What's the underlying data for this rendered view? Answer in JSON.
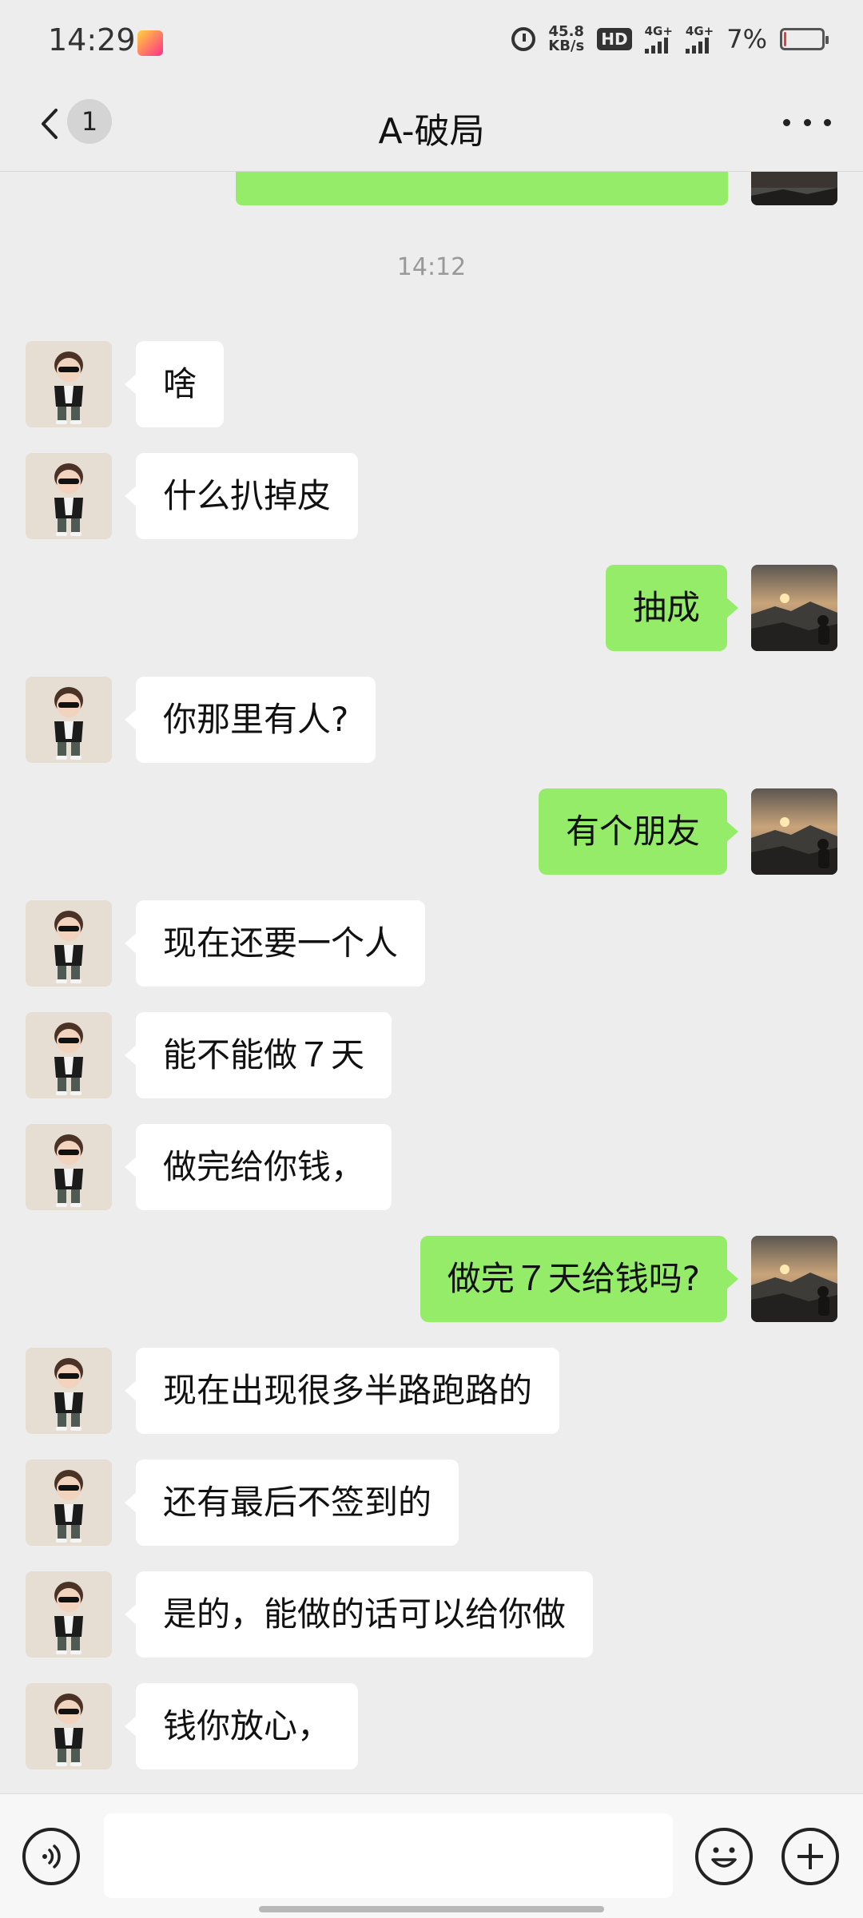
{
  "status_bar": {
    "time": "14:29",
    "net_speed_value": "45.8",
    "net_speed_unit": "KB/s",
    "hd_label": "HD",
    "sim1_label": "4G+",
    "sim2_label": "4G+",
    "battery_percent": "7%",
    "battery_level": 0.07,
    "battery_color": "#e04040"
  },
  "header": {
    "unread_count": "1",
    "title": "A-破局"
  },
  "chat": {
    "timestamp": "14:12",
    "messages": [
      {
        "side": "recv",
        "text": "啥"
      },
      {
        "side": "recv",
        "text": "什么扒掉皮"
      },
      {
        "side": "sent",
        "text": "抽成"
      },
      {
        "side": "recv",
        "text": "你那里有人?"
      },
      {
        "side": "sent",
        "text": "有个朋友"
      },
      {
        "side": "recv",
        "text": "现在还要一个人"
      },
      {
        "side": "recv",
        "text": "能不能做７天"
      },
      {
        "side": "recv",
        "text": "做完给你钱，"
      },
      {
        "side": "sent",
        "text": "做完７天给钱吗?"
      },
      {
        "side": "recv",
        "text": "现在出现很多半路跑路的"
      },
      {
        "side": "recv",
        "text": "还有最后不签到的"
      },
      {
        "side": "recv",
        "text": "是的，能做的话可以给你做"
      },
      {
        "side": "recv",
        "text": "钱你放心，"
      }
    ]
  },
  "input_bar": {
    "placeholder": ""
  },
  "colors": {
    "background": "#ededed",
    "sent_bubble": "#95ec69",
    "recv_bubble": "#ffffff",
    "timestamp": "#999999"
  },
  "icons": {
    "back": "chevron-left-icon",
    "more": "more-dots-icon",
    "voice": "voice-icon",
    "emoji": "emoji-icon",
    "plus": "plus-icon"
  }
}
